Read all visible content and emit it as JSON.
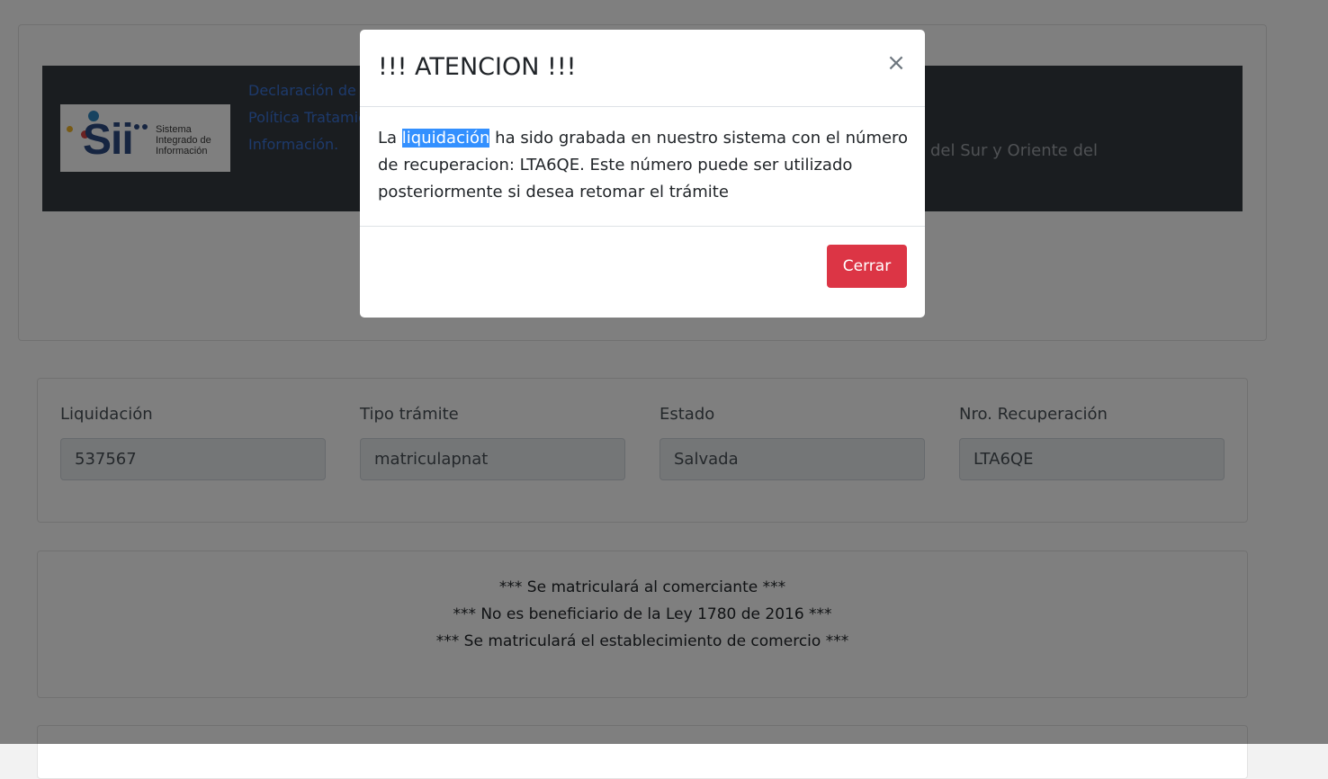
{
  "header": {
    "logo_title": "Sii",
    "logo_subtitle": [
      "Sistema",
      "Integrado de",
      "Información"
    ],
    "links": [
      "Declaración de",
      "Política Tratamiento",
      "Información."
    ],
    "right_text": "del Sur y Oriente del"
  },
  "fields": [
    {
      "label": "Liquidación",
      "value": "537567"
    },
    {
      "label": "Tipo trámite",
      "value": "matriculapnat"
    },
    {
      "label": "Estado",
      "value": "Salvada"
    },
    {
      "label": "Nro. Recuperación",
      "value": "LTA6QE"
    }
  ],
  "messages": [
    "*** Se matriculará al comerciante ***",
    "*** No es beneficiario de la Ley 1780 de 2016 ***",
    "*** Se matriculará el establecimiento de comercio ***"
  ],
  "modal": {
    "title": "!!! ATENCION !!!",
    "close_symbol": "×",
    "body_prefix": "La",
    "body_highlight": "liquidación",
    "body_suffix": "ha sido grabada en nuestro sistema con el número de recuperacion: LTA6QE. Este número puede ser utilizado posteriormente si desea retomar el trámite",
    "close_button": "Cerrar"
  },
  "colors": {
    "banner": "#343a40",
    "danger": "#dc3545",
    "selection": "#3390ff",
    "link": "#3b74d9"
  }
}
